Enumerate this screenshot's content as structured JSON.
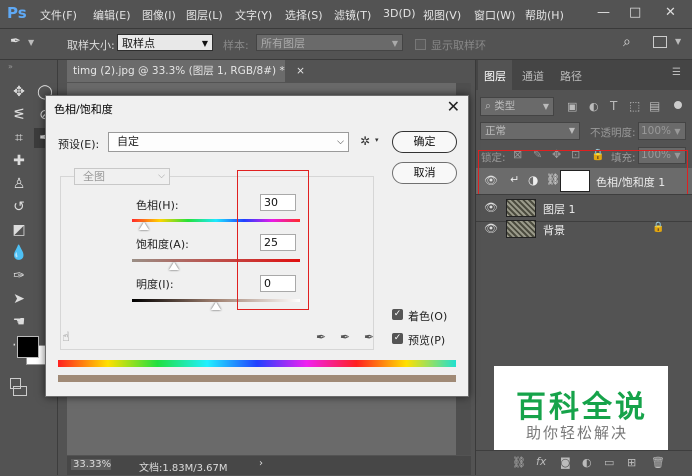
{
  "app": {
    "logo": "Ps"
  },
  "menu": [
    "文件(F)",
    "编辑(E)",
    "图像(I)",
    "图层(L)",
    "文字(Y)",
    "选择(S)",
    "滤镜(T)",
    "3D(D)",
    "视图(V)",
    "窗口(W)",
    "帮助(H)"
  ],
  "window_controls": {
    "minimize": "—",
    "maximize": "□",
    "close": "✕"
  },
  "options": {
    "sample_size_label": "取样大小:",
    "sample_size_value": "取样点",
    "sample_label": "样本:",
    "sample_value": "所有图层",
    "show_ring_label": "显示取样环"
  },
  "document": {
    "tab_title": "timg (2).jpg @ 33.3% (图层 1, RGB/8#) *",
    "tab_close": "×",
    "zoom": "33.33%",
    "doc_info": "文档:1.83M/3.67M",
    "status_arrow": "›"
  },
  "layers_panel": {
    "tabs": [
      "图层",
      "通道",
      "路径"
    ],
    "filter_type": "类型",
    "blend_mode": "正常",
    "opacity_label": "不透明度:",
    "opacity_value": "100%",
    "lock_label": "锁定:",
    "fill_label": "填充:",
    "fill_value": "100%",
    "layers": [
      {
        "name": "色相/饱和度 1"
      },
      {
        "name": "图层 1"
      },
      {
        "name": "背景"
      }
    ]
  },
  "dialog": {
    "title": "色相/饱和度",
    "close": "✕",
    "preset_label": "预设(E):",
    "preset_value": "自定",
    "channel_value": "全图",
    "ok_label": "确定",
    "cancel_label": "取消",
    "hue_label": "色相(H):",
    "hue_value": "30",
    "saturation_label": "饱和度(A):",
    "saturation_value": "25",
    "lightness_label": "明度(I):",
    "lightness_value": "0",
    "colorize_label": "着色(O)",
    "preview_label": "预览(P)",
    "colorize_checked": true,
    "preview_checked": true,
    "result_bar_color": "#a08a76"
  },
  "watermark": {
    "logo": "百科全说",
    "subtitle": "助你轻松解决"
  },
  "colors": {
    "highlight": "#e02020",
    "brand_green": "#16a34a",
    "ps_blue": "#5fa9f5"
  }
}
